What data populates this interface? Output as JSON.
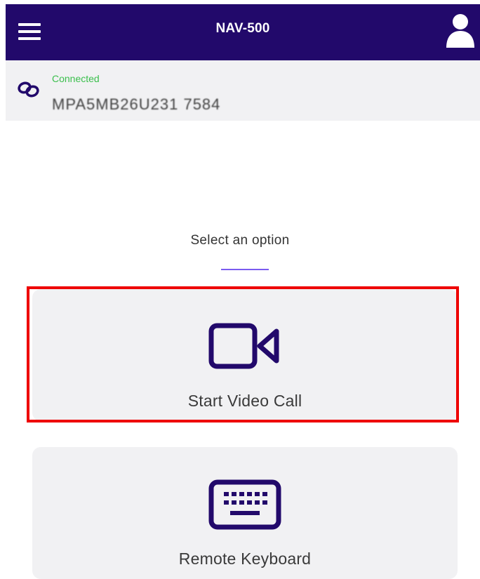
{
  "header": {
    "title": "NAV-500",
    "menu_icon": "hamburger-menu-icon",
    "profile_icon": "user-profile-icon",
    "background_color": "#22096b"
  },
  "connection": {
    "icon": "link-icon",
    "status": "Connected",
    "status_color": "#3bbf4d",
    "device_id": "MPA5MB26U231 7584"
  },
  "main": {
    "prompt": "Select an option",
    "accent_color": "#7b5cf0",
    "options": [
      {
        "label": "Start Video Call",
        "icon": "video-camera-icon",
        "highlighted": true
      },
      {
        "label": "Remote Keyboard",
        "icon": "keyboard-icon",
        "highlighted": false
      }
    ],
    "highlight_color": "#ee0000"
  }
}
